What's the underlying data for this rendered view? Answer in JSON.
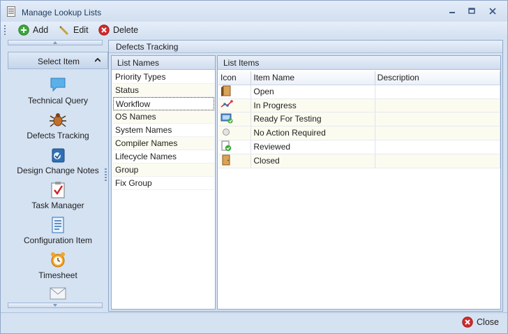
{
  "window": {
    "title": "Manage Lookup Lists"
  },
  "toolbar": {
    "add_label": "Add",
    "edit_label": "Edit",
    "delete_label": "Delete"
  },
  "nav": {
    "header_label": "Select Item",
    "items": [
      {
        "label": "Technical Query",
        "icon": "speech-bubble-icon"
      },
      {
        "label": "Defects Tracking",
        "icon": "bug-icon"
      },
      {
        "label": "Design Change Notes",
        "icon": "notes-icon"
      },
      {
        "label": "Task Manager",
        "icon": "checklist-icon"
      },
      {
        "label": "Configuration Item",
        "icon": "document-icon"
      },
      {
        "label": "Timesheet",
        "icon": "alarm-clock-icon"
      }
    ]
  },
  "content": {
    "section_title": "Defects Tracking",
    "list_names": {
      "header": "List Names",
      "items": [
        "Priority Types",
        "Status",
        "Workflow",
        "OS Names",
        "System Names",
        "Compiler Names",
        "Lifecycle Names",
        "Group",
        "Fix Group"
      ],
      "selected": "Workflow"
    },
    "list_items": {
      "header": "List Items",
      "columns": [
        "Icon",
        "Item Name",
        "Description"
      ],
      "rows": [
        {
          "icon": "door-open-icon",
          "name": "Open",
          "description": ""
        },
        {
          "icon": "progress-chart-icon",
          "name": "In Progress",
          "description": ""
        },
        {
          "icon": "ready-testing-icon",
          "name": "Ready For Testing",
          "description": ""
        },
        {
          "icon": "no-action-icon",
          "name": "No Action Required",
          "description": ""
        },
        {
          "icon": "reviewed-icon",
          "name": "Reviewed",
          "description": ""
        },
        {
          "icon": "door-closed-icon",
          "name": "Closed",
          "description": ""
        }
      ]
    }
  },
  "footer": {
    "close_label": "Close"
  },
  "colors": {
    "accent": "#1e395b",
    "frame": "#d5e2f2",
    "border": "#8fa7c8"
  }
}
